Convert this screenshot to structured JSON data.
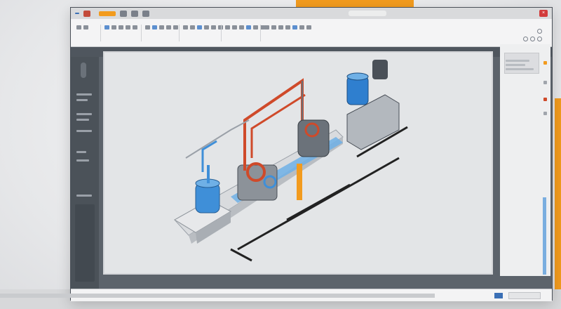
{
  "window": {
    "app_badge": "",
    "close_label": "×"
  },
  "header": {
    "title": ""
  },
  "toolbar": {
    "groups": [
      "",
      "",
      "",
      "",
      "",
      ""
    ]
  },
  "right_panel": {
    "title": ""
  },
  "status": {
    "text": ""
  },
  "colors": {
    "accent": "#f29b1e",
    "primary": "#3a6fb5",
    "close": "#d23b3b",
    "pipe_red": "#cf4a2a",
    "tank_blue": "#3f8fd8",
    "canvas_bg": "#e3e5e7"
  },
  "icons": [
    "close-icon",
    "settings-icon",
    "search-icon",
    "help-icon",
    "layers-icon"
  ]
}
